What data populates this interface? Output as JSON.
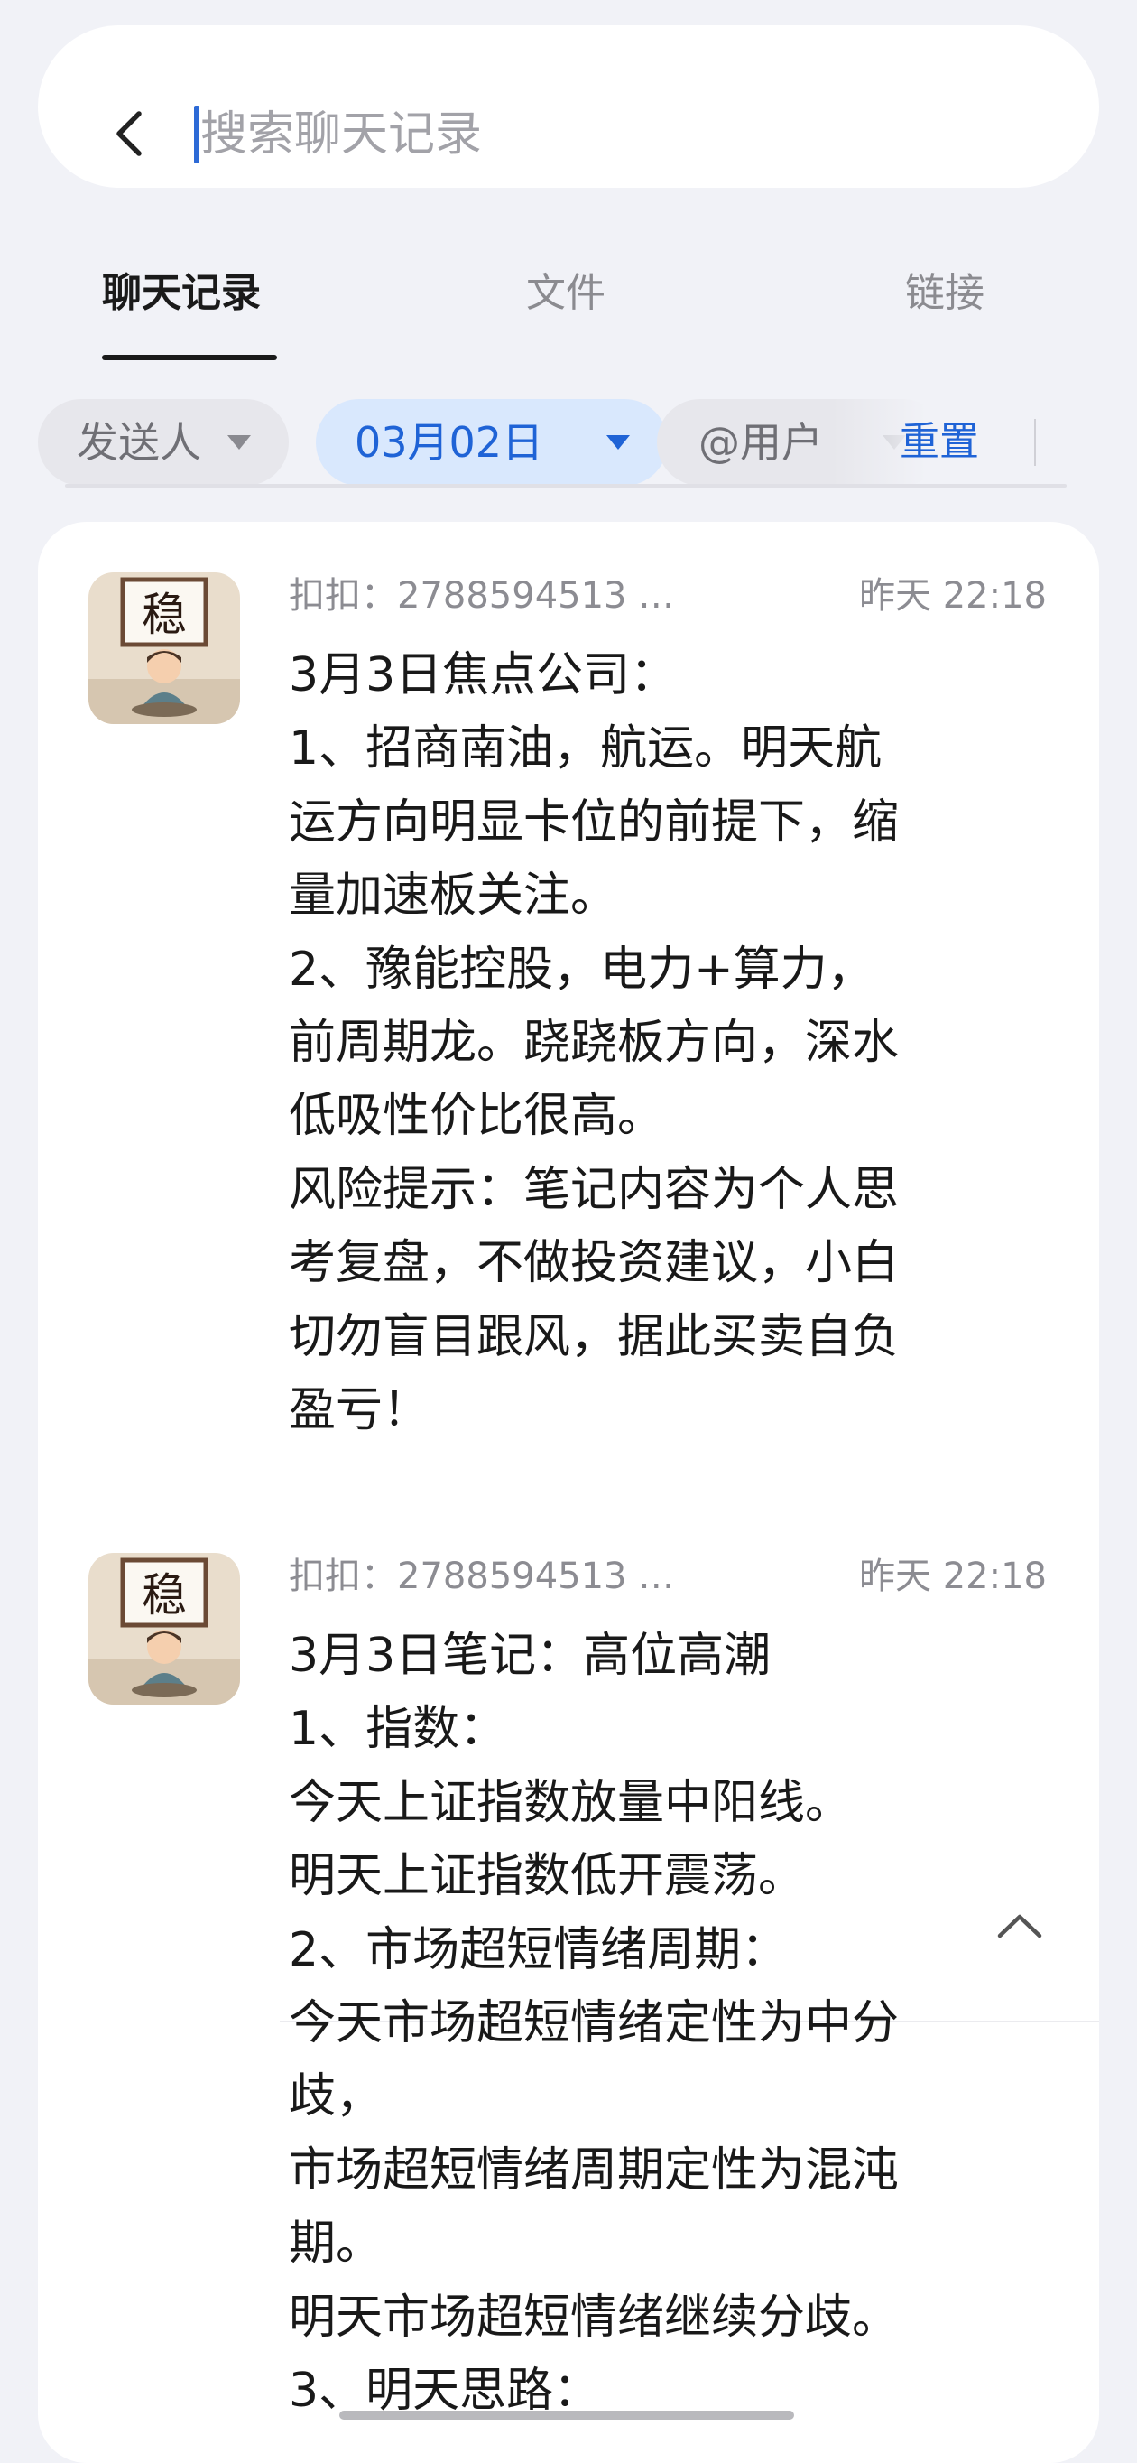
{
  "search": {
    "placeholder": "搜索聊天记录",
    "value": ""
  },
  "tabs": [
    {
      "label": "聊天记录",
      "active": true
    },
    {
      "label": "文件",
      "active": false
    },
    {
      "label": "链接",
      "active": false
    }
  ],
  "filters": {
    "sender": "发送人",
    "date": "03月02日",
    "mention": "@用户",
    "reset": "重置"
  },
  "icons": {
    "back": "chevron-left-icon",
    "dropdown": "triangle-down-icon",
    "collapse": "chevron-up-icon",
    "avatar": "stable-character-avatar"
  },
  "colors": {
    "accent": "#1f63d6",
    "chip_active_bg": "#d9e8fd",
    "page_bg": "#f1f2f7"
  },
  "avatar_text": "稳",
  "results": [
    {
      "sender": "扣扣：2788594513 …",
      "time": "昨天 22:18",
      "lines": [
        "3月3日焦点公司：",
        "1、招商南油，航运。明天航",
        "运方向明显卡位的前提下，缩",
        "量加速板关注。",
        "2、豫能控股，电力+算力，",
        "前周期龙。跷跷板方向，深水",
        "低吸性价比很高。",
        "风险提示：笔记内容为个人思",
        "考复盘，不做投资建议，小白",
        "切勿盲目跟风，据此买卖自负",
        "盈亏！"
      ]
    },
    {
      "sender": "扣扣：2788594513 …",
      "time": "昨天 22:18",
      "lines": [
        "3月3日笔记：高位高潮",
        "1、指数：",
        "今天上证指数放量中阳线。",
        "明天上证指数低开震荡。",
        "2、市场超短情绪周期：",
        "今天市场超短情绪定性为中分",
        "歧，",
        "市场超短情绪周期定性为混沌",
        "期。",
        "明天市场超短情绪继续分歧。",
        "3、明天思路："
      ]
    }
  ]
}
